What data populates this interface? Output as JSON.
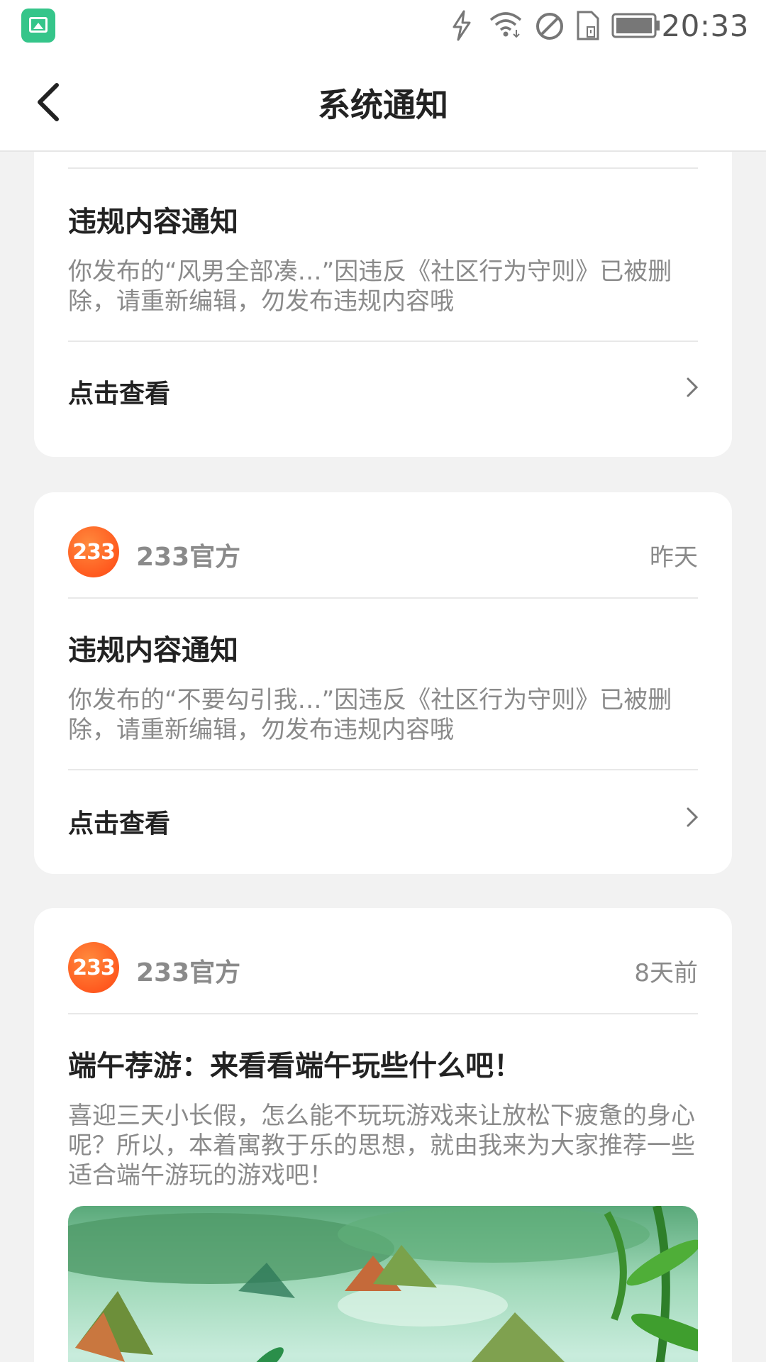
{
  "status_bar": {
    "time": "20:33",
    "icons": [
      "gallery-app-icon",
      "charging-icon",
      "wifi-icon",
      "do-not-disturb-icon",
      "sim-card-icon",
      "battery-icon"
    ]
  },
  "header": {
    "title": "系统通知",
    "back_icon": "back-arrow-icon"
  },
  "notifications": [
    {
      "title": "违规内容通知",
      "body": "你发布的“风男全部凑…”因违反《社区行为守则》已被删除，请重新编辑，勿发布违规内容哦",
      "action": "点击查看"
    },
    {
      "sender": "233官方",
      "avatar_text": "233",
      "time": "昨天",
      "title": "违规内容通知",
      "body": "你发布的“不要勾引我…”因违反《社区行为守则》已被删除，请重新编辑，勿发布违规内容哦",
      "action": "点击查看"
    },
    {
      "sender": "233官方",
      "avatar_text": "233",
      "time": "8天前",
      "title": "端午荐游：来看看端午玩些什么吧！",
      "body": "喜迎三天小长假，怎么能不玩玩游戏来让放松下疲惫的身心呢？所以，本着寓教于乐的思想，就由我来为大家推荐一些适合端午游玩的游戏吧！"
    }
  ],
  "colors": {
    "accent": "#ff5a1f",
    "background": "#f2f2f2",
    "card": "#ffffff",
    "muted_text": "#8a8a8a"
  }
}
